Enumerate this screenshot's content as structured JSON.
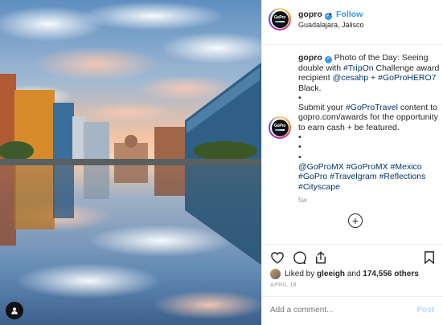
{
  "header": {
    "username": "gopro",
    "separator": "•",
    "follow_label": "Follow",
    "location": "Guadalajara, Jalisco",
    "avatar_text": "GoPro"
  },
  "caption": {
    "username": "gopro",
    "lines": [
      {
        "text": "Photo of the Day: Seeing"
      },
      {
        "text": "double with "
      },
      {
        "text": "#TripOn"
      },
      {
        "text": " Challenge award"
      },
      {
        "text": "recipient "
      },
      {
        "text": "@cesahp"
      },
      {
        "text": " + "
      },
      {
        "text": "#GoProHERO7"
      },
      {
        "text": "Black."
      },
      {
        "text": "•"
      },
      {
        "text": "Submit your "
      },
      {
        "text": "#GoProTravel"
      },
      {
        "text": " content to"
      },
      {
        "text": "gopro.com/awards for the opportunity"
      },
      {
        "text": "to earn cash + be featured."
      },
      {
        "text": "•"
      },
      {
        "text": "•"
      },
      {
        "text": "•"
      },
      {
        "text": "@GoProMX #GoProMX #Mexico"
      },
      {
        "text": "#GoPro #Travelgram #Reflections"
      },
      {
        "text": "#Cityscape"
      }
    ],
    "time_ago": "5w"
  },
  "load_more_symbol": "+",
  "actions": {
    "icons": [
      "heart-icon",
      "comment-icon",
      "share-icon",
      "bookmark-icon"
    ]
  },
  "likes": {
    "prefix": "Liked by ",
    "user": "gleeigh",
    "conjunction": " and ",
    "others": "174,556 others"
  },
  "date": "APRIL 18",
  "comment_box": {
    "placeholder": "Add a comment...",
    "post_label": "Post"
  },
  "colors": {
    "link": "#003569",
    "follow": "#3897f0",
    "post_disabled": "#b3dbff",
    "muted": "#999999",
    "text": "#262626"
  }
}
